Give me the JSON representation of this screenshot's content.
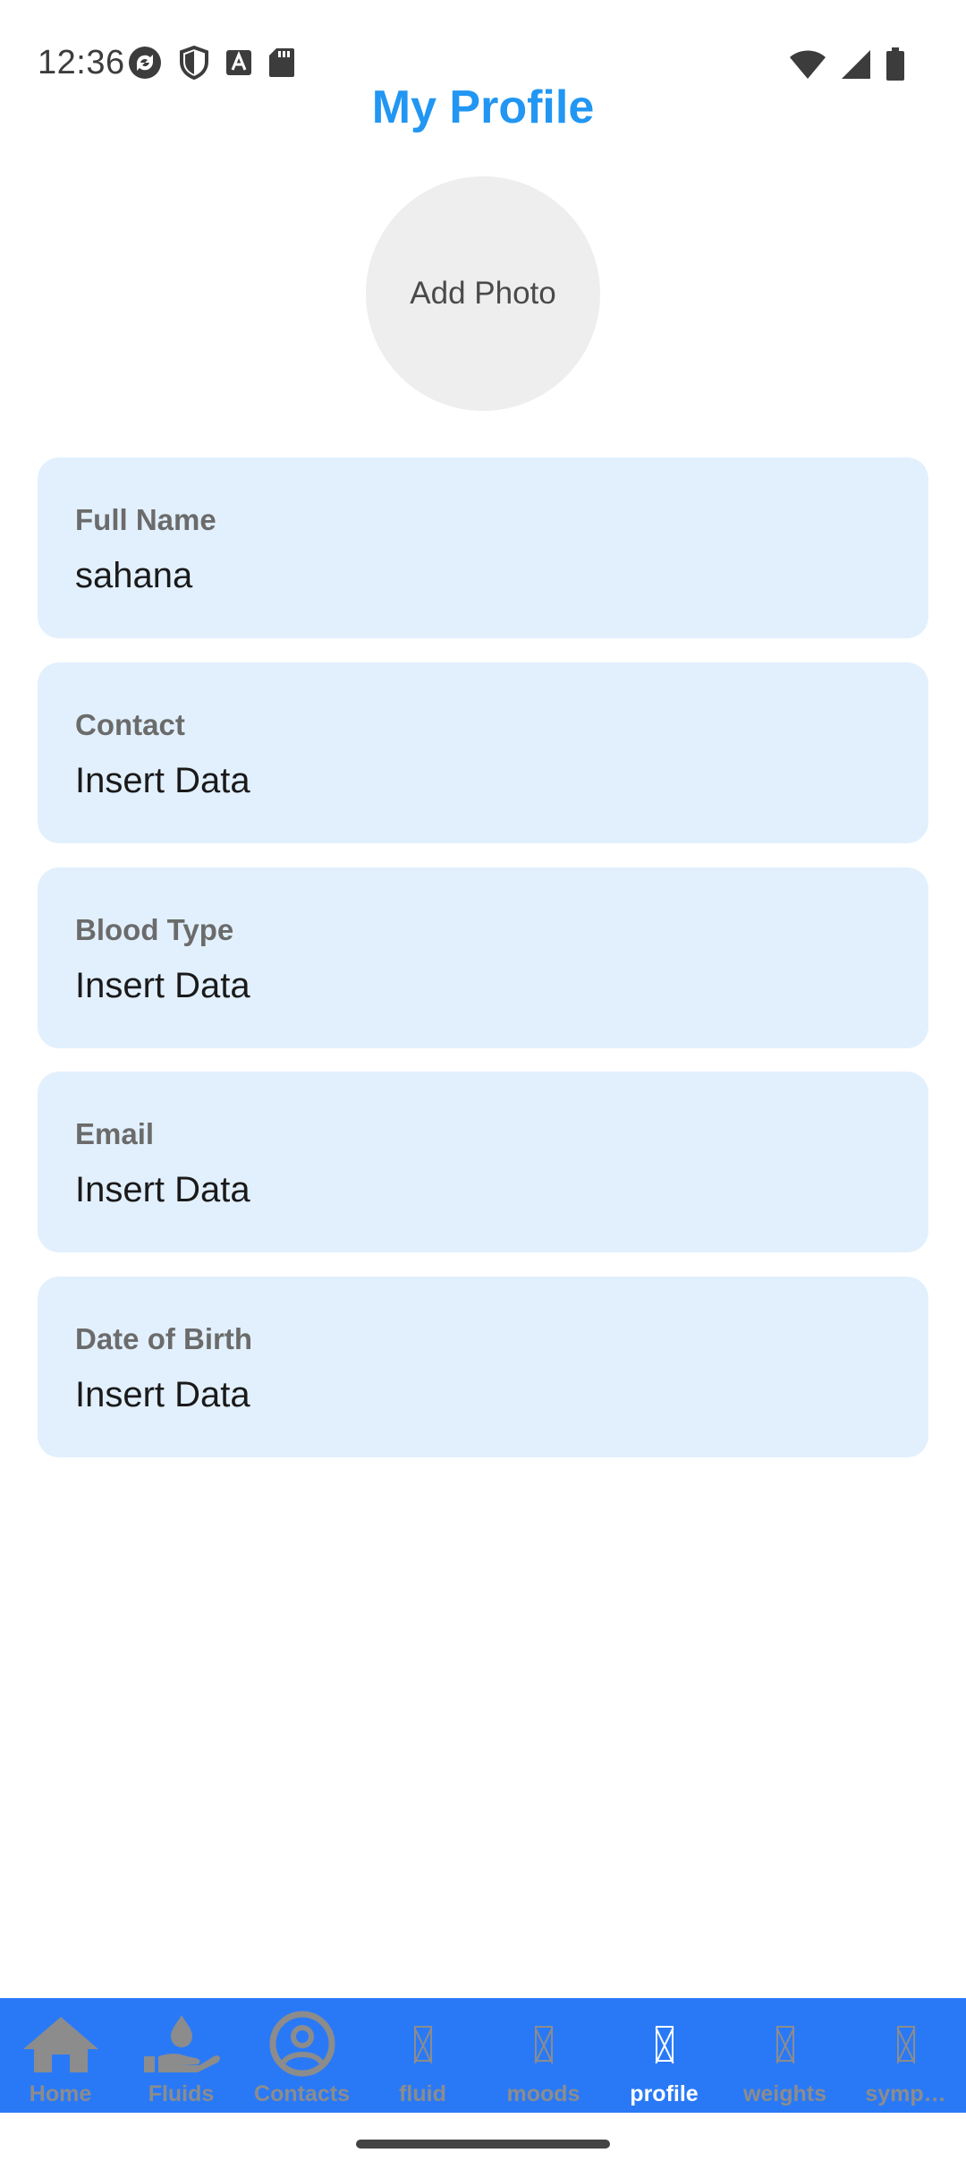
{
  "status_bar": {
    "time": "12:36",
    "left_icons": [
      "sync-icon",
      "shield-icon",
      "font-icon",
      "sd-card-icon"
    ],
    "right_icons": [
      "wifi-icon",
      "cell-signal-icon",
      "battery-icon"
    ]
  },
  "header": {
    "title": "My Profile",
    "title_color": "#2196f3"
  },
  "avatar": {
    "label": "Add Photo"
  },
  "fields": [
    {
      "label": "Full Name",
      "value": "sahana"
    },
    {
      "label": "Contact",
      "value": "Insert Data"
    },
    {
      "label": "Blood Type",
      "value": "Insert Data"
    },
    {
      "label": "Email",
      "value": "Insert Data"
    },
    {
      "label": "Date of Birth",
      "value": "Insert Data"
    }
  ],
  "colors": {
    "card_background": "#e2f0fd",
    "nav_background": "#2979f7",
    "nav_inactive": "#8c8c8c",
    "nav_active": "#ffffff"
  },
  "bottom_nav": {
    "items": [
      {
        "label": "Home",
        "icon": "home-icon",
        "active": false
      },
      {
        "label": "Fluids",
        "icon": "hand-drop-icon",
        "active": false
      },
      {
        "label": "Contacts",
        "icon": "account-circle-icon",
        "active": false
      },
      {
        "label": "fluid",
        "icon": "missing-glyph-icon",
        "active": false
      },
      {
        "label": "moods",
        "icon": "missing-glyph-icon",
        "active": false
      },
      {
        "label": "profile",
        "icon": "missing-glyph-icon",
        "active": true
      },
      {
        "label": "weights",
        "icon": "missing-glyph-icon",
        "active": false
      },
      {
        "label": "symp…",
        "icon": "missing-glyph-icon",
        "active": false
      }
    ]
  }
}
